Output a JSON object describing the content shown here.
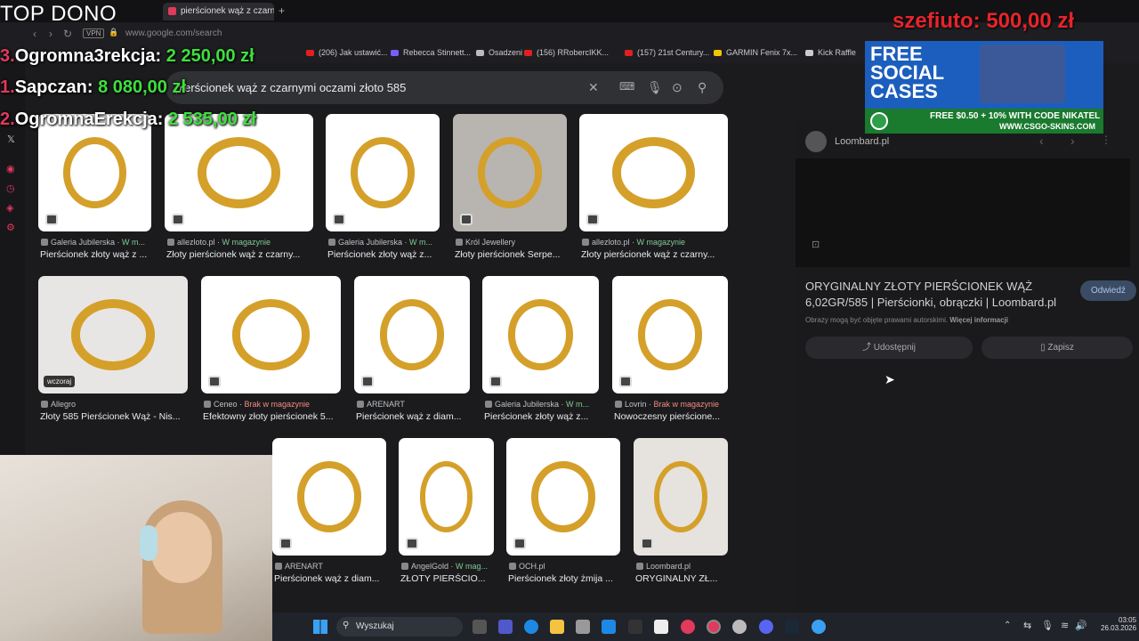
{
  "browser": {
    "active_tab": "pierścionek wąż z czarnymi",
    "new_tab": "+",
    "vpn": "VPN",
    "url": "www.google.com/search",
    "bookmarks": [
      {
        "label": "(206) Jak ustawić...",
        "color": "#e02020"
      },
      {
        "label": "Rebecca Stinnett...",
        "color": "#7a5cff"
      },
      {
        "label": "Osadzeni",
        "color": "#bbbbbb"
      },
      {
        "label": "(156) RRobercIKK...",
        "color": "#e02020"
      },
      {
        "label": "(157) 21st Century...",
        "color": "#e02020"
      },
      {
        "label": "GARMIN Fenix 7x...",
        "color": "#f5c400"
      },
      {
        "label": "Kick Raffle",
        "color": "#cccccc"
      }
    ]
  },
  "search": {
    "query": "pierścionek wąż z czarnymi oczami złoto 585"
  },
  "results": [
    {
      "source": "Galeria Jubilerska",
      "status": "W m...",
      "status_type": "g",
      "title": "Pierścionek złoty wąż z ...",
      "bg": "#ffffff"
    },
    {
      "source": "allezloto.pl",
      "status": "W magazynie",
      "status_type": "g",
      "title": "Złoty pierścionek wąż z czarny...",
      "bg": "#ffffff"
    },
    {
      "source": "Galeria Jubilerska",
      "status": "W m...",
      "status_type": "g",
      "title": "Pierścionek złoty wąż z...",
      "bg": "#ffffff"
    },
    {
      "source": "Król Jewellery",
      "status": "",
      "status_type": "g",
      "title": "Złoty pierścionek Serpe...",
      "bg": "#b8b4b0"
    },
    {
      "source": "allezloto.pl",
      "status": "W magazynie",
      "status_type": "g",
      "title": "Złoty pierścionek wąż z czarny...",
      "bg": "#ffffff"
    },
    {
      "source": "Allegro",
      "status": "",
      "status_type": "g",
      "title": "Złoty 585 Pierścionek Wąż - Nis...",
      "bg": "#e8e6e4",
      "badge": "wczoraj"
    },
    {
      "source": "Ceneo",
      "status": "Brak w magazynie",
      "status_type": "r",
      "title": "Efektowny złoty pierścionek 5...",
      "bg": "#ffffff"
    },
    {
      "source": "ARENART",
      "status": "",
      "status_type": "g",
      "title": "Pierścionek wąż z diam...",
      "bg": "#ffffff"
    },
    {
      "source": "Galeria Jubilerska",
      "status": "W m...",
      "status_type": "g",
      "title": "Pierścionek złoty wąż z...",
      "bg": "#ffffff"
    },
    {
      "source": "Lovrin",
      "status": "Brak w magazynie",
      "status_type": "r",
      "title": "Nowoczesny pierścione...",
      "bg": "#ffffff"
    },
    {
      "source": "ARENART",
      "status": "",
      "status_type": "g",
      "title": "Pierścionek wąż z diam...",
      "bg": "#ffffff"
    },
    {
      "source": "AngelGold",
      "status": "W mag...",
      "status_type": "g",
      "title": "ZŁOTY PIERŚCIO...",
      "bg": "#ffffff"
    },
    {
      "source": "OCH.pl",
      "status": "",
      "status_type": "g",
      "title": "Pierścionek złoty żmija ...",
      "bg": "#ffffff"
    },
    {
      "source": "Loombard.pl",
      "status": "",
      "status_type": "g",
      "title": "ORYGINALNY ZŁ...",
      "bg": "#e6e2de"
    }
  ],
  "panel": {
    "site": "Loombard.pl",
    "title": "ORYGINALNY ZŁOTY PIERŚCIONEK WĄŻ 6,02GR/585 | Pierścionki, obrączki | Loombard.pl",
    "visit": "Odwiedź",
    "note": "Obrazy mogą być objęte prawami autorskimi.",
    "note_link": "Więcej informacji",
    "share": "Udostępnij",
    "save": "Zapisz"
  },
  "overlay": {
    "top_dono": "TOP DONO",
    "donations": [
      {
        "num": "3.",
        "name": "Ogromna3rekcja:",
        "amount": "2 250,00 zł"
      },
      {
        "num": "1.",
        "name": "Sapczan:",
        "amount": "8 080,00 zł"
      },
      {
        "num": "2.",
        "name": "OgromnaErekcja:",
        "amount": "2 535,00 zł"
      }
    ],
    "top_donor": "szefiuto: 500,00 zł"
  },
  "ad": {
    "line1": "FREE",
    "line2": "SOCIAL",
    "line3": "CASES",
    "offer": "FREE $0.50 + 10% WITH CODE NIKATEL",
    "site": "WWW.CSGO-SKINS.COM"
  },
  "taskbar": {
    "search": "Wyszukaj",
    "time": "03:05",
    "date": "26.03.2026"
  }
}
